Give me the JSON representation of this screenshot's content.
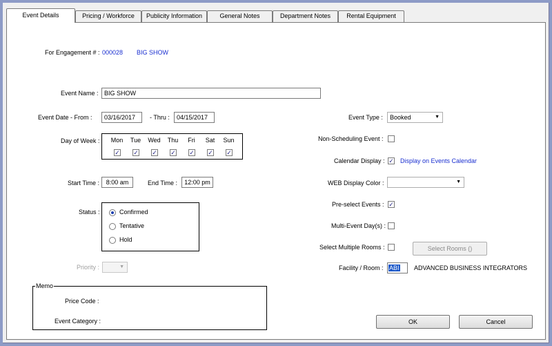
{
  "tabs": [
    {
      "label": "Event Details",
      "active": true
    },
    {
      "label": "Pricing / Workforce",
      "active": false
    },
    {
      "label": "Publicity Information",
      "active": false
    },
    {
      "label": "General Notes",
      "active": false
    },
    {
      "label": "Department Notes",
      "active": false
    },
    {
      "label": "Rental Equipment",
      "active": false
    }
  ],
  "engagement": {
    "label": "For Engagement # :",
    "number": "000028",
    "name": "BIG SHOW"
  },
  "event_name": {
    "label": "Event Name :",
    "value": "BIG SHOW"
  },
  "event_date": {
    "from_label": "Event Date - From :",
    "from_value": "03/16/2017",
    "thru_label": "- Thru :",
    "thru_value": "04/15/2017"
  },
  "day_of_week": {
    "label": "Day of Week :",
    "days": [
      {
        "name": "Mon",
        "checked": true
      },
      {
        "name": "Tue",
        "checked": true
      },
      {
        "name": "Wed",
        "checked": true
      },
      {
        "name": "Thu",
        "checked": true
      },
      {
        "name": "Fri",
        "checked": true
      },
      {
        "name": "Sat",
        "checked": true
      },
      {
        "name": "Sun",
        "checked": true
      }
    ]
  },
  "time": {
    "start_label": "Start Time :",
    "start_value": "8:00 am",
    "end_label": "End Time :",
    "end_value": "12:00 pm"
  },
  "status": {
    "label": "Status :",
    "options": [
      {
        "label": "Confirmed",
        "selected": true
      },
      {
        "label": "Tentative",
        "selected": false
      },
      {
        "label": "Hold",
        "selected": false
      }
    ]
  },
  "priority": {
    "label": "Priority :",
    "value": ""
  },
  "memo": {
    "legend": "Memo",
    "price_code_label": "Price Code :",
    "price_code_value": "",
    "category_label": "Event Category :",
    "category_value": ""
  },
  "event_type": {
    "label": "Event Type :",
    "value": "Booked"
  },
  "non_scheduling": {
    "label": "Non-Scheduling Event :",
    "checked": false
  },
  "calendar_display": {
    "label": "Calendar Display :",
    "checked": true,
    "text": "Display on Events Calendar"
  },
  "web_color": {
    "label": "WEB Display Color :",
    "value": ""
  },
  "preselect_events": {
    "label": "Pre-select Events :",
    "checked": true
  },
  "multi_event": {
    "label": "Multi-Event Day(s) :",
    "checked": false
  },
  "multiple_rooms": {
    "label": "Select Multiple Rooms :",
    "checked": false,
    "button_label": "Select Rooms ()"
  },
  "facility": {
    "label": "Facility / Room :",
    "code": "ABI",
    "name": "ADVANCED BUSINESS INTEGRATORS"
  },
  "buttons": {
    "ok": "OK",
    "cancel": "Cancel"
  },
  "colors": {
    "accent_text": "#1a2fd0",
    "window_bg": "#8d9bc6"
  }
}
